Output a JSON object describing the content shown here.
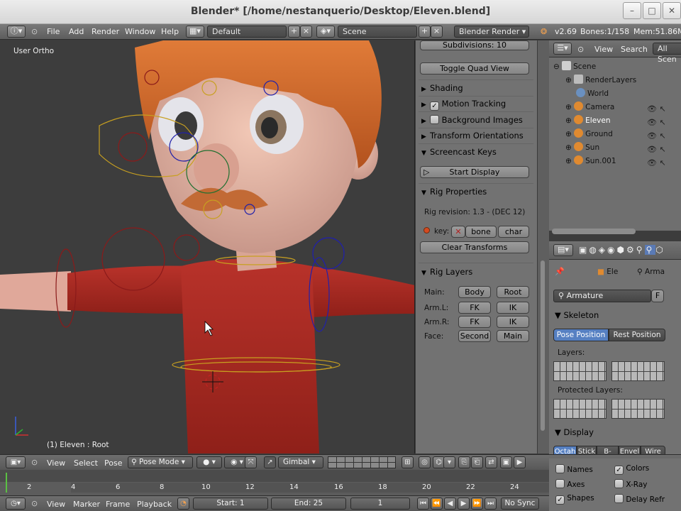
{
  "window": {
    "title": "Blender* [/home/nestanquerio/Desktop/Eleven.blend]"
  },
  "menu": {
    "items": [
      "File",
      "Add",
      "Render",
      "Window",
      "Help"
    ]
  },
  "layout": {
    "screen": "Default",
    "scene": "Scene",
    "engine": "Blender Render"
  },
  "stats": {
    "version": "v2.69",
    "bones": "Bones:1/158",
    "mem": "Mem:51.86M"
  },
  "viewport": {
    "view_label": "User Ortho",
    "status": "(1) Eleven : Root"
  },
  "npanel": {
    "subdivisions": "Subdivisions: 10",
    "toggle_quad": "Toggle Quad View",
    "shading": "Shading",
    "motion_tracking": "Motion Tracking",
    "background_images": "Background Images",
    "transform_orientations": "Transform Orientations",
    "screencast_keys": "Screencast Keys",
    "start_display": "Start Display",
    "rig_properties": "Rig Properties",
    "rig_revision": "Rig revision: 1.3 - (DEC 12)",
    "key_label": "key:",
    "key_bone": "bone",
    "key_char": "char",
    "clear_transforms": "Clear Transforms",
    "rig_layers": "Rig Layers",
    "rows": [
      {
        "label": "Main:",
        "a": "Body",
        "b": "Root"
      },
      {
        "label": "Arm.L:",
        "a": "FK",
        "b": "IK"
      },
      {
        "label": "Arm.R:",
        "a": "FK",
        "b": "IK"
      },
      {
        "label": "Face:",
        "a": "Second",
        "b": "Main"
      }
    ]
  },
  "outliner": {
    "view": "View",
    "search": "Search",
    "all_scenes": "All Scen",
    "items": [
      "Scene",
      "RenderLayers",
      "World",
      "Camera",
      "Eleven",
      "Ground",
      "Sun",
      "Sun.001"
    ]
  },
  "properties": {
    "breadcrumb_obj": "Ele",
    "breadcrumb_arm": "Arma",
    "datablock": "Armature",
    "datablock_flag": "F",
    "skeleton": "Skeleton",
    "pose_position": "Pose Position",
    "rest_position": "Rest Position",
    "layers": "Layers:",
    "protected_layers": "Protected Layers:",
    "display": "Display",
    "display_tabs": [
      "Octah",
      "Stick",
      "B-Bon",
      "Envel",
      "Wire"
    ],
    "checks": [
      {
        "label": "Names",
        "checked": false
      },
      {
        "label": "Colors",
        "checked": true
      },
      {
        "label": "Axes",
        "checked": false
      },
      {
        "label": "X-Ray",
        "checked": false
      },
      {
        "label": "Shapes",
        "checked": true
      },
      {
        "label": "Delay Refr",
        "checked": false
      }
    ]
  },
  "view3d_header": {
    "view": "View",
    "select": "Select",
    "pose": "Pose",
    "mode": "Pose Mode",
    "orientation": "Gimbal"
  },
  "timeline": {
    "ticks": [
      "2",
      "4",
      "6",
      "8",
      "10",
      "12",
      "14",
      "16",
      "18",
      "20",
      "22",
      "24"
    ]
  },
  "timeline_header": {
    "view": "View",
    "marker": "Marker",
    "frame": "Frame",
    "playback": "Playback",
    "start": "Start: 1",
    "end": "End: 25",
    "current": "1",
    "sync": "No Sync"
  }
}
